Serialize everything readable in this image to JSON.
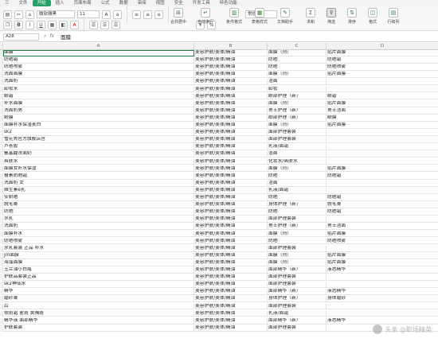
{
  "menu_tabs": [
    "三",
    "文件",
    "开始",
    "插入",
    "页面布局",
    "公式",
    "数据",
    "审阅",
    "视图",
    "安全",
    "开发工具",
    "特色功能"
  ],
  "menu_active_index": 2,
  "ribbon": {
    "font_name": "微软雅黑",
    "font_size": "11",
    "number_format": "常规",
    "tools": [
      {
        "label": "合并居中",
        "icon": "merge-icon"
      },
      {
        "label": "自动换行",
        "icon": "wrap-icon"
      },
      {
        "label": "条件格式",
        "icon": "conditional-format-icon"
      },
      {
        "label": "表格样式",
        "icon": "table-style-icon"
      },
      {
        "label": "文档助手",
        "icon": "doc-assistant-icon"
      },
      {
        "label": "求和",
        "icon": "sum-icon"
      },
      {
        "label": "筛选",
        "icon": "filter-icon"
      },
      {
        "label": "排序",
        "icon": "sort-icon"
      },
      {
        "label": "格式",
        "icon": "format-icon"
      },
      {
        "label": "行和列",
        "icon": "row-col-icon"
      }
    ],
    "active_tool": "筛选"
  },
  "formula_bar": {
    "cell_ref": "A28",
    "content": "面膜"
  },
  "columns": [
    "A",
    "B",
    "C",
    "D"
  ],
  "rows": [
    [
      "面膜",
      "美容护肤/美体/精油",
      "面膜（剂）",
      "贴片面膜"
    ],
    [
      "防晒霜",
      "美容护肤/美体/精油",
      "防晒",
      "防晒霜"
    ],
    [
      "防晒喷雾",
      "美容护肤/美体/精油",
      "防晒",
      "防晒喷雾"
    ],
    [
      "洗面面膜",
      "美容护肤/美体/精油",
      "面膜（剂）",
      "贴片面膜"
    ],
    [
      "洗面奶",
      "美容护肤/美体/精油",
      "洁面",
      ""
    ],
    [
      "卸妆水",
      "美容护肤/美体/精油",
      "卸妆",
      ""
    ],
    [
      "眼霜",
      "美容护肤/美体/精油",
      "眼部护理（新）",
      "眼霜"
    ],
    [
      "补水面膜",
      "美容护肤/美体/精油",
      "面膜（剂）",
      "贴片面膜"
    ],
    [
      "洗面奶男",
      "美容护肤/美体/精油",
      "男士护理（新）",
      "男士洁面"
    ],
    [
      "眼膜",
      "美容护肤/美体/精油",
      "眼部护理（新）",
      "眼膜"
    ],
    [
      "面膜补水保湿美白",
      "美容护肤/美体/精油",
      "面膜（剂）",
      "贴片面膜"
    ],
    [
      "sk2",
      "美容护肤/美体/精油",
      "面部护理套装",
      ""
    ],
    [
      "雪花秀官方旗舰店官",
      "美容护肤/美体/精油",
      "面部护理套装",
      ""
    ],
    [
      "芦荟胶",
      "美容护肤/美体/精油",
      "乳液/面霜",
      ""
    ],
    [
      "氨基酸洗面奶",
      "美容护肤/美体/精油",
      "洁面",
      ""
    ],
    [
      "爽肤水",
      "美容护肤/美体/精油",
      "化妆水/爽肤水",
      ""
    ],
    [
      "面膜女补水保湿",
      "美容护肤/美体/精油",
      "面膜（剂）",
      "贴片面膜"
    ],
    [
      "簪素防晒霜",
      "美容护肤/美体/精油",
      "防晒",
      "防晒霜"
    ],
    [
      "洗面奶 女",
      "美容护肤/美体/精油",
      "洁面",
      ""
    ],
    [
      "维生素e乳",
      "美容护肤/美体/精油",
      "乳液/面霜",
      ""
    ],
    [
      "安耐晒",
      "美容护肤/美体/精油",
      "防晒",
      "防晒霜"
    ],
    [
      "脱毛膏",
      "美容护肤/美体/精油",
      "身体护理（新）",
      "脱毛膏"
    ],
    [
      "防晒",
      "美容护肤/美体/精油",
      "防晒",
      "防晒霜"
    ],
    [
      "水乳",
      "美容护肤/美体/精油",
      "面部护理套装",
      ""
    ],
    [
      "洗面奶",
      "美容护肤/美体/精油",
      "男士护理（新）",
      "男士洁面"
    ],
    [
      "面膜补水",
      "美容护肤/美体/精油",
      "面膜（剂）",
      "贴片面膜"
    ],
    [
      "防晒喷雾",
      "美容护肤/美体/精油",
      "防晒",
      "防晒喷雾"
    ],
    [
      "水乳套装 正品 补水",
      "美容护肤/美体/精油",
      "面部护理套装",
      ""
    ],
    [
      "jm面膜",
      "美容护肤/美体/精油",
      "面膜（剂）",
      "贴片面膜"
    ],
    [
      "海藻面膜",
      "美容护肤/美体/精油",
      "面膜（剂）",
      "贴片面膜"
    ],
    [
      "玉兰油小白瓶",
      "美容护肤/美体/精油",
      "面部精华（新）",
      "液态精华"
    ],
    [
      "护肤品套装正品",
      "美容护肤/美体/精油",
      "面部护理套装",
      ""
    ],
    [
      "sk2神仙水",
      "美容护肤/美体/精油",
      "面部护理套装",
      ""
    ],
    [
      "精华",
      "美容护肤/美体/精油",
      "面部精华（新）",
      "液态精华"
    ],
    [
      "磨砂膏",
      "美容护肤/美体/精油",
      "身体护理（新）",
      "身体磨砂"
    ],
    [
      "后",
      "美容护肤/美体/精油",
      "面部护理套装",
      ""
    ],
    [
      "祛斑霜 雀斑 黄褐斑",
      "美容护肤/美体/精油",
      "乳液/面霜",
      ""
    ],
    [
      "精华液 面部精华",
      "美容护肤/美体/精油",
      "面部精华（新）",
      "液态精华"
    ],
    [
      "护肤套装",
      "美容护肤/美体/精油",
      "面部护理套装",
      ""
    ]
  ],
  "selected_row_index": 0,
  "watermark_text": "头条 @职场精英"
}
